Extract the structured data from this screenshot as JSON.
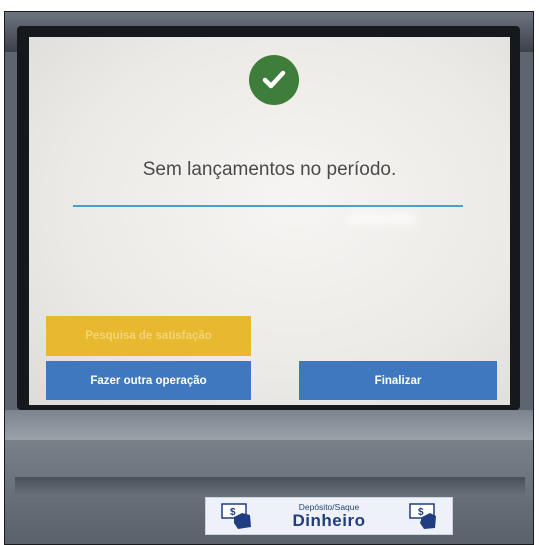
{
  "screen": {
    "message": "Sem lançamentos no período.",
    "buttons": {
      "survey_label": "Pesquisa de satisfação",
      "other_operation_label": "Fazer outra operação",
      "finish_label": "Finalizar"
    },
    "status_icon": "check-circle-icon",
    "colors": {
      "success": "#3f7d3a",
      "survey_button": "#e8b92e",
      "action_button": "#3f78be",
      "divider": "#4e9fc2"
    }
  },
  "slot_label": {
    "small": "Depósito/Saque",
    "big": "Dinheiro",
    "icon": "cash-hand-icon"
  }
}
